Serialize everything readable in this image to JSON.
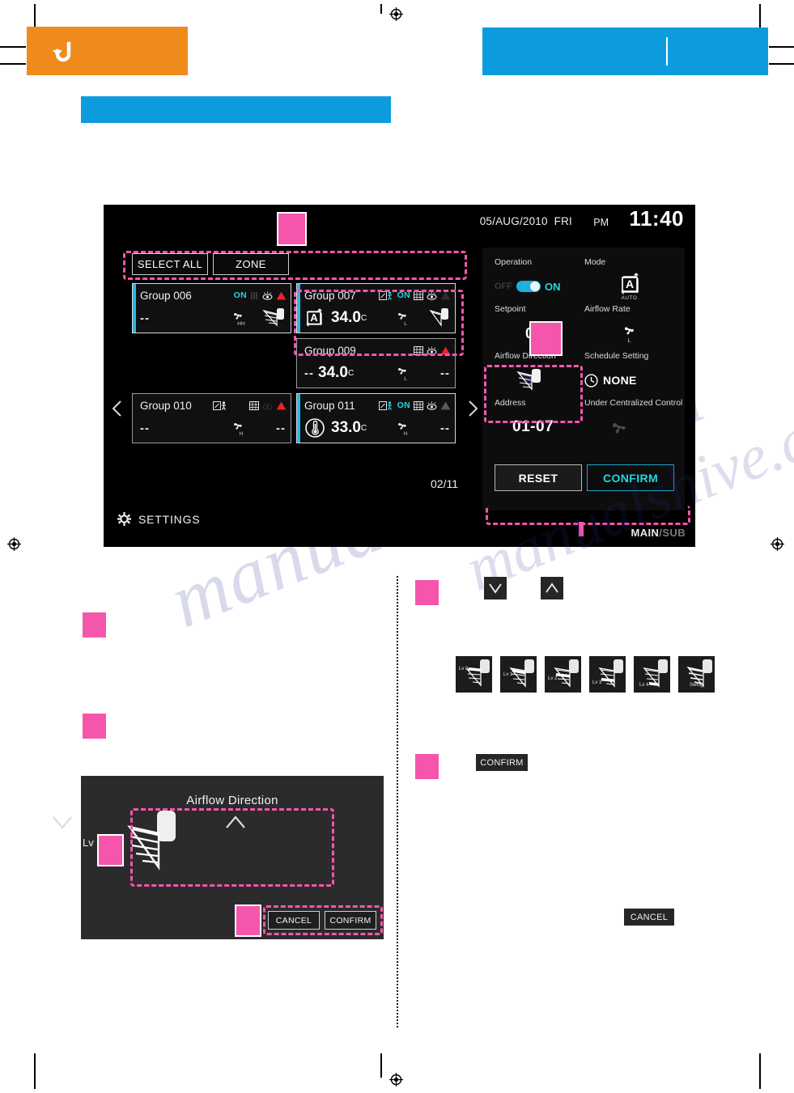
{
  "header": {
    "back_icon": "back-arrow-icon",
    "orange_bar_label": "",
    "blue_bar_right_label": "",
    "blue_bar_sub_label": "",
    "accent_orange": "#F08A1C",
    "accent_blue": "#0C9CDE",
    "accent_pink": "#F556AC"
  },
  "device": {
    "statusbar": {
      "date": "05/AUG/2010",
      "weekday": "FRI",
      "ampm": "PM",
      "time": "11:40"
    },
    "toolbar": {
      "select_all": "SELECT ALL",
      "zone": "ZONE"
    },
    "nav": {
      "prev_icon": "chevron-left-icon",
      "next_icon": "chevron-right-icon",
      "page_count": "02/11"
    },
    "settings_label": "SETTINGS",
    "settings_icon": "gear-icon",
    "groups": [
      {
        "name": "Group 006",
        "selected": true,
        "power": "ON",
        "mode": "none",
        "temp": "--",
        "fan": "HH",
        "icons": [
          "filter-icon",
          "eye-icon",
          "alert-icon"
        ],
        "airflow": "fan-vane-icon"
      },
      {
        "name": "Group 007",
        "selected": true,
        "power": "ON",
        "mode": "AUTO",
        "temp": "34.0",
        "unit": "C",
        "fan": "L",
        "icons": [
          "person-sensor-icon",
          "filter-icon",
          "eye-icon"
        ],
        "airflow": "fan-vane-icon"
      },
      {
        "name": "",
        "blank": true
      },
      {
        "name": "Group 009",
        "selected": false,
        "power": "",
        "mode": "none",
        "temp": "34.0",
        "unit": "C",
        "fan": "L",
        "icons": [
          "filter-icon",
          "eye-icon",
          "alert-icon"
        ],
        "airflow": "--"
      },
      {
        "name": "Group 010",
        "selected": false,
        "power": "",
        "mode": "none",
        "temp": "--",
        "fan": "H",
        "icons": [
          "person-sensor-icon",
          "filter-icon",
          "eye-dim-icon",
          "alert-icon"
        ],
        "airflow": "--"
      },
      {
        "name": "Group 011",
        "selected": true,
        "power": "ON",
        "mode": "THERMO",
        "temp": "33.0",
        "unit": "C",
        "fan": "H",
        "icons": [
          "person-sensor-icon",
          "filter-icon",
          "eye-icon",
          "alert-dim-icon"
        ],
        "airflow": "--"
      }
    ],
    "detail": {
      "operation": {
        "label": "Operation",
        "off_label": "OFF",
        "on_label": "ON",
        "state": "ON"
      },
      "mode": {
        "label": "Mode",
        "icon": "auto-mode-icon",
        "caption": "AUTO"
      },
      "setpoint": {
        "label": "Setpoint",
        "value": "0°C"
      },
      "airflow_rate": {
        "label": "Airflow Rate",
        "icon": "fan-icon",
        "caption": "L"
      },
      "airflow_direction": {
        "label": "Airflow Direction",
        "icon": "vane-icon"
      },
      "schedule": {
        "label": "Schedule Setting",
        "icon": "clock-icon",
        "value": "NONE"
      },
      "address": {
        "label": "Address",
        "value": "01-07"
      },
      "centralized": {
        "label": "Under Centralized Control",
        "icon": "propeller-icon"
      },
      "buttons": {
        "reset": "RESET",
        "confirm": "CONFIRM"
      },
      "footer_main": "MAIN",
      "footer_sub": "/SUB"
    }
  },
  "dialog": {
    "title": "Airflow Direction",
    "down_icon": "chevron-down-icon",
    "up_icon": "chevron-up-icon",
    "level_label": "Lv 1",
    "vane_icon": "vane-icon",
    "cancel": "CANCEL",
    "confirm": "CONFIRM"
  },
  "right_column": {
    "step_down_icon": "chevron-down-icon",
    "step_up_icon": "chevron-up-icon",
    "confirm_chip": "CONFIRM",
    "cancel_chip": "CANCEL",
    "levels": [
      {
        "label": "Lv 0",
        "angle": 0
      },
      {
        "label": "Lv 1",
        "angle": 1
      },
      {
        "label": "Lv 2",
        "angle": 2
      },
      {
        "label": "Lv 3",
        "angle": 3
      },
      {
        "label": "Lv 4",
        "angle": 4
      },
      {
        "label": "Swing",
        "angle": 5
      }
    ]
  },
  "watermark": {
    "line1": "manualshive.com"
  }
}
